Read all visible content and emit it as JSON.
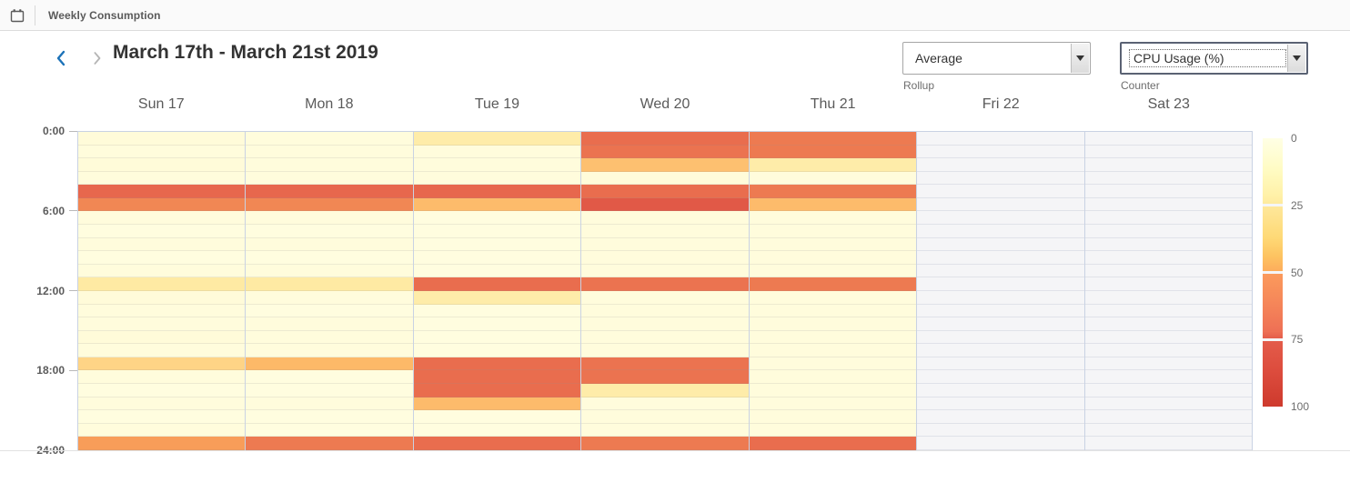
{
  "titlebar": {
    "icon": "calendar-icon",
    "title": "Weekly Consumption"
  },
  "toolbar": {
    "prev_label": "‹",
    "next_label": "›",
    "range_title": "March 17th - March 21st 2019",
    "rollup": {
      "value": "Average",
      "label": "Rollup",
      "focused": false
    },
    "counter": {
      "value": "CPU Usage (%)",
      "label": "Counter",
      "focused": true
    }
  },
  "chart_data": {
    "type": "heatmap",
    "title": "Weekly Consumption",
    "subtitle": "March 17th - March 21st 2019",
    "xlabel": "",
    "ylabel": "",
    "legend_position": "right",
    "grid": true,
    "categories": [
      "Sun 17",
      "Mon 18",
      "Tue 19",
      "Wed 20",
      "Thu 21",
      "Fri 22",
      "Sat 23"
    ],
    "y_tick_labels": [
      "0:00",
      "6:00",
      "12:00",
      "18:00",
      "24:00"
    ],
    "y_tick_hours": [
      0,
      6,
      12,
      18,
      24
    ],
    "y_range_hours": [
      0,
      24
    ],
    "cell_hours": 1,
    "value_unit": "CPU Usage (%)",
    "zlim": [
      0,
      100
    ],
    "legend_ticks": [
      0,
      25,
      50,
      75,
      100
    ],
    "colorscale": [
      {
        "stop": 0,
        "color": "#ffffe5"
      },
      {
        "stop": 25,
        "color": "#fee79a"
      },
      {
        "stop": 50,
        "color": "#fdad5c"
      },
      {
        "stop": 75,
        "color": "#e45d4b"
      },
      {
        "stop": 100,
        "color": "#ce3a2d"
      }
    ],
    "no_data_color": "#f5f5f7",
    "series": [
      {
        "name": "Sun 17",
        "values": [
          4,
          3,
          4,
          3,
          72,
          62,
          3,
          2,
          3,
          2,
          3,
          22,
          4,
          3,
          3,
          4,
          3,
          33,
          3,
          2,
          3,
          2,
          3,
          55
        ]
      },
      {
        "name": "Mon 18",
        "values": [
          3,
          3,
          3,
          3,
          72,
          62,
          3,
          2,
          3,
          2,
          3,
          22,
          3,
          2,
          3,
          3,
          3,
          45,
          2,
          2,
          3,
          2,
          2,
          66
        ]
      },
      {
        "name": "Tue 19",
        "values": [
          20,
          3,
          3,
          3,
          72,
          44,
          2,
          2,
          2,
          2,
          2,
          70,
          20,
          2,
          2,
          2,
          2,
          70,
          70,
          70,
          44,
          2,
          2,
          70
        ]
      },
      {
        "name": "Wed 20",
        "values": [
          70,
          68,
          42,
          4,
          70,
          78,
          3,
          3,
          3,
          3,
          3,
          68,
          3,
          3,
          3,
          3,
          3,
          68,
          68,
          20,
          3,
          3,
          3,
          66
        ]
      },
      {
        "name": "Thu 21",
        "values": [
          66,
          66,
          20,
          3,
          66,
          44,
          3,
          3,
          3,
          3,
          3,
          66,
          3,
          3,
          3,
          3,
          3,
          3,
          3,
          3,
          3,
          3,
          3,
          70
        ]
      },
      {
        "name": "Fri 22",
        "values": [
          null,
          null,
          null,
          null,
          null,
          null,
          null,
          null,
          null,
          null,
          null,
          null,
          null,
          null,
          null,
          null,
          null,
          null,
          null,
          null,
          null,
          null,
          null,
          null
        ]
      },
      {
        "name": "Sat 23",
        "values": [
          null,
          null,
          null,
          null,
          null,
          null,
          null,
          null,
          null,
          null,
          null,
          null,
          null,
          null,
          null,
          null,
          null,
          null,
          null,
          null,
          null,
          null,
          null,
          null
        ]
      }
    ]
  }
}
